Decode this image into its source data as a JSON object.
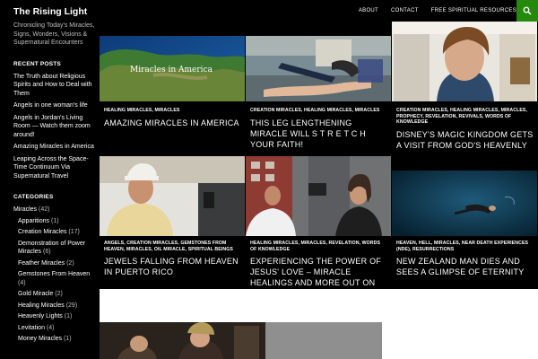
{
  "site": {
    "title": "The Rising Light",
    "description": "Chronicling Today's Miracles, Signs, Wonders, Visions & Supernatural Encounters"
  },
  "nav": {
    "items": [
      "ABOUT",
      "CONTACT",
      "FREE SPIRITUAL RESOURCES"
    ],
    "search_icon": "search-icon",
    "search_color": "#24890d"
  },
  "sidebar": {
    "recent_posts_title": "RECENT POSTS",
    "recent_posts": [
      "The Truth about Religious Spirits and How to Deal with Them",
      "Angels in one woman's life",
      "Angels in Jordan's Living Room — Watch them zoom around!",
      "Amazing Miracles in America",
      "Leaping Across the Space-Time Continuum Via Supernatural Travel"
    ],
    "categories_title": "CATEGORIES",
    "categories": {
      "parent": {
        "name": "Miracles",
        "count": "(42)"
      },
      "children": [
        {
          "name": "Apparitions",
          "count": "(1)"
        },
        {
          "name": "Creation Miracles",
          "count": "(17)"
        },
        {
          "name": "Demonstration of Power Miracles",
          "count": "(6)"
        },
        {
          "name": "Feather Miracles",
          "count": "(2)"
        },
        {
          "name": "Gemstones From Heaven",
          "count": "(4)"
        },
        {
          "name": "Gold Miracle",
          "count": "(2)"
        },
        {
          "name": "Healing Miracles",
          "count": "(29)"
        },
        {
          "name": "Heavenly Lights",
          "count": "(1)"
        },
        {
          "name": "Levitation",
          "count": "(4)"
        },
        {
          "name": "Money Miracles",
          "count": "(1)"
        }
      ]
    }
  },
  "featured": [
    {
      "categories": "HEALING MIRACLES, MIRACLES",
      "title": "AMAZING MIRACLES IN AMERICA",
      "thumb_caption": "Miracles in America"
    },
    {
      "categories": "CREATION MIRACLES, HEALING MIRACLES, MIRACLES",
      "title": "THIS LEG LENGTHENING MIRACLE WILL S T R E T C H YOUR FAITH!"
    },
    {
      "categories": "CREATION MIRACLES, HEALING MIRACLES, MIRACLES, PROPHECY, REVELATION, REVIVALS, WORDS OF KNOWLEDGE",
      "title": "DISNEY'S MAGIC KINGDOM GETS A VISIT FROM GOD'S HEAVENLY"
    },
    {
      "categories": "ANGELS, CREATION MIRACLES, GEMSTONES FROM HEAVEN, MIRACLES, OIL MIRACLE, SPIRITUAL BEINGS",
      "title": "JEWELS FALLING FROM HEAVEN IN PUERTO RICO"
    },
    {
      "categories": "HEALING MIRACLES, MIRACLES, REVELATION, WORDS OF KNOWLEDGE",
      "title": "EXPERIENCING THE POWER OF JESUS' LOVE – MIRACLE HEALINGS AND MORE OUT ON"
    },
    {
      "categories": "HEAVEN, HELL, MIRACLES, NEAR DEATH EXPERIENCES (NDE), RESURRECTIONS",
      "title": "NEW ZEALAND MAN DIES AND SEES A GLIMPSE OF ETERNITY"
    }
  ]
}
